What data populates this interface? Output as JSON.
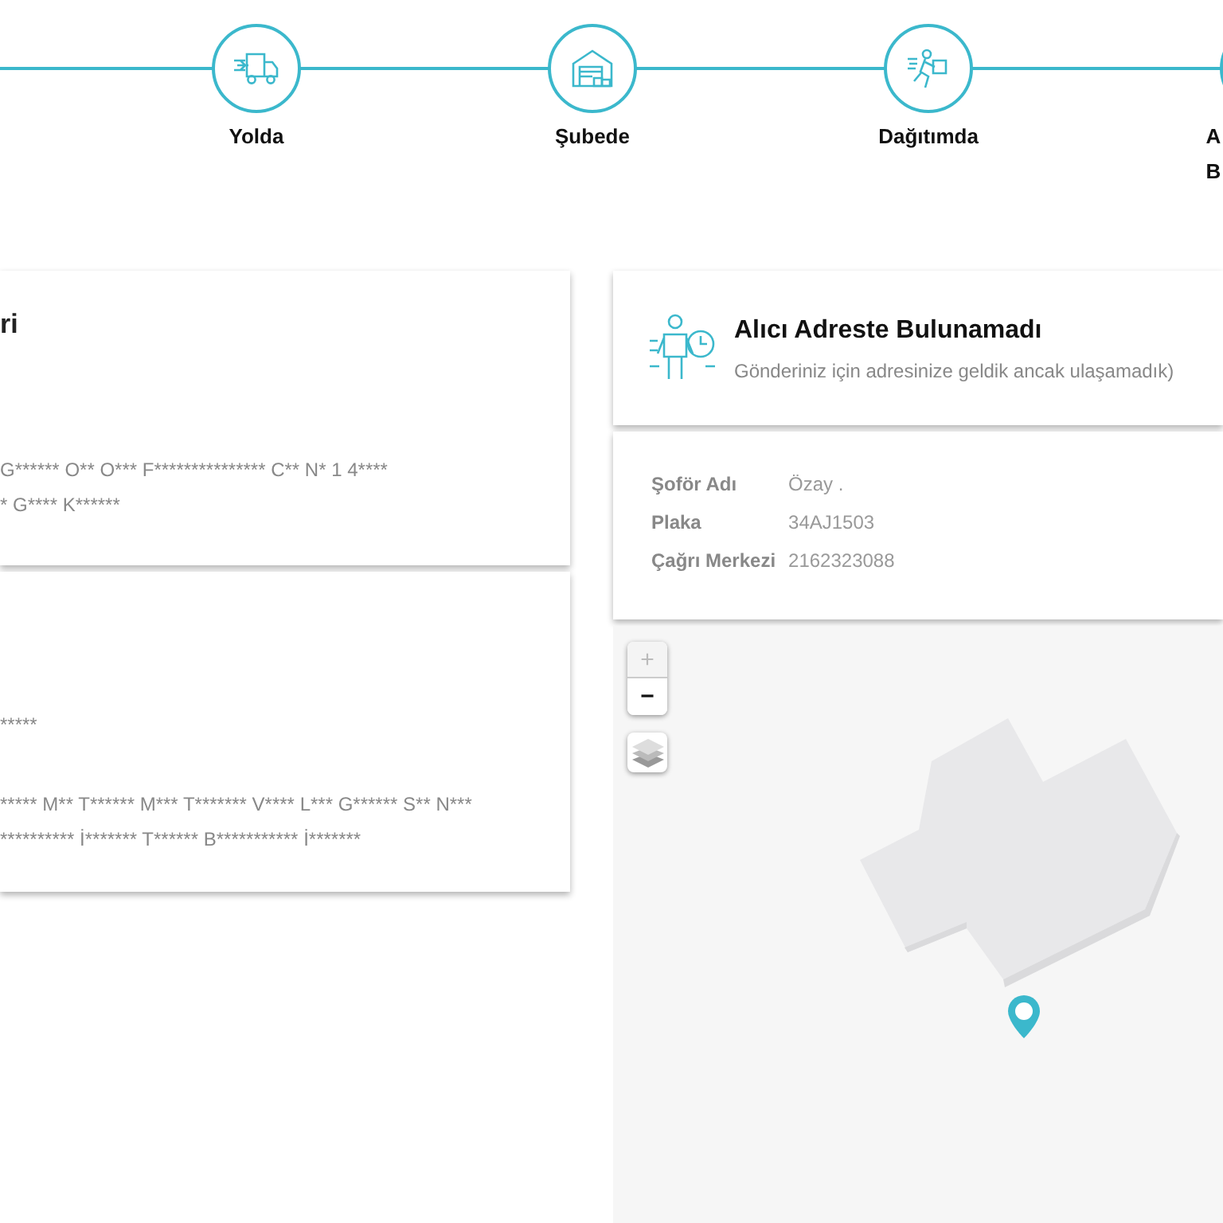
{
  "steps": [
    {
      "kind": "truck",
      "label_lines": [
        "Yolda"
      ]
    },
    {
      "kind": "warehouse",
      "label_lines": [
        "Şubede"
      ]
    },
    {
      "kind": "courier",
      "label_lines": [
        "Dağıtımda"
      ]
    },
    {
      "kind": "partial",
      "label_lines": [
        "A",
        "B"
      ]
    }
  ],
  "left_cards": [
    {
      "title": "ri",
      "lines": [
        "G****** O** O*** F*************** C** N* 1 4****",
        "* G**** K******"
      ]
    },
    {
      "lines": [
        "*****",
        "***** M** T****** M*** T******* V**** L*** G****** S** N***",
        "********** İ******* T****** B*********** İ*******"
      ]
    }
  ],
  "status": {
    "title": "Alıcı Adreste Bulunamadı",
    "description": "Gönderiniz için adresinize geldik ancak ulaşamadık)"
  },
  "driver": [
    {
      "label": "Şoför Adı",
      "value": "Özay ."
    },
    {
      "label": "Plaka",
      "value": "34AJ1503"
    },
    {
      "label": "Çağrı Merkezi",
      "value": "2162323088"
    }
  ],
  "map": {
    "zoom_in": {
      "label": "+",
      "disabled": true
    },
    "zoom_out": {
      "label": "−",
      "disabled": false
    }
  }
}
